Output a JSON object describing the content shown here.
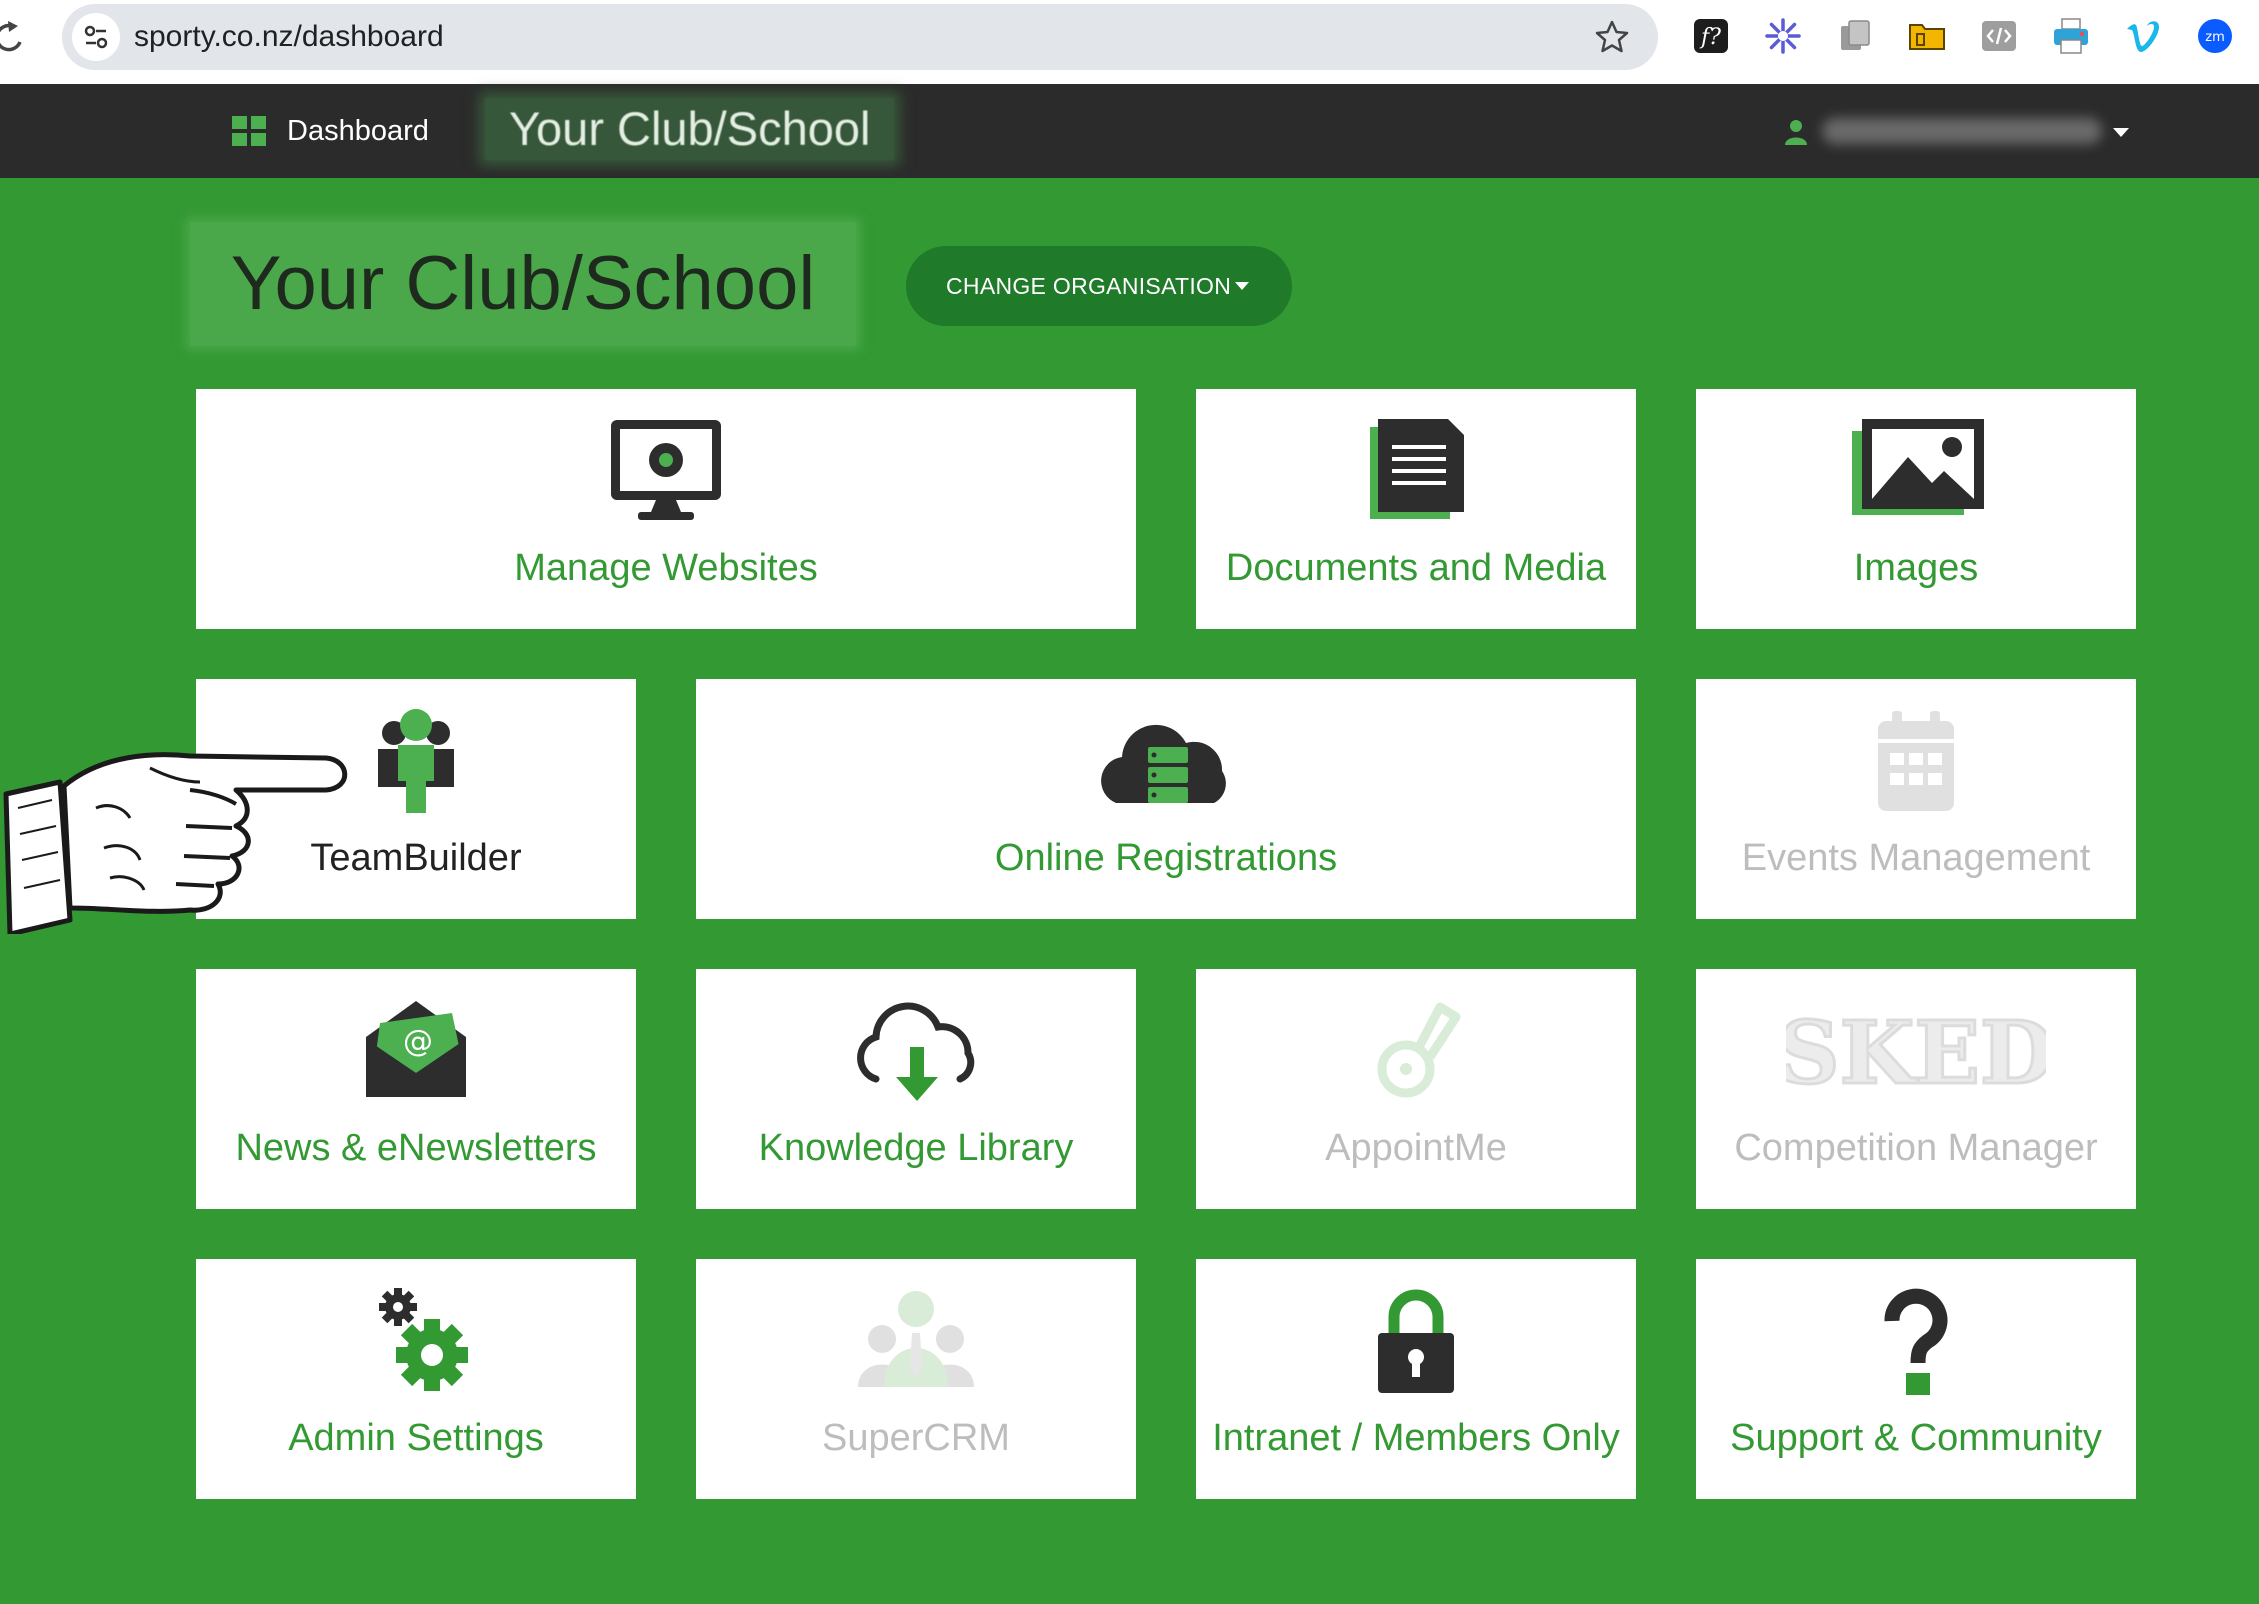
{
  "browser": {
    "url": "sporty.co.nz/dashboard",
    "extensions": [
      "formula-icon",
      "asterisk-icon",
      "copy-icon",
      "folder-icon",
      "code-icon",
      "printer-icon",
      "vimeo-icon",
      "zoom-icon"
    ]
  },
  "navbar": {
    "dashboard_label": "Dashboard",
    "club_name": "Your Club/School"
  },
  "header": {
    "org_title": "Your Club/School",
    "change_org_label": "CHANGE ORGANISATION"
  },
  "colors": {
    "page_bg": "#339933",
    "navbar_bg": "#2b2b2b",
    "accent_green": "#339933",
    "dark_green_button": "#1f7a2a",
    "disabled_text": "#bdbdbd"
  },
  "tiles": [
    {
      "label": "Manage Websites",
      "icon": "monitor-icon",
      "state": "active"
    },
    {
      "label": "Documents and Media",
      "icon": "document-icon",
      "state": "active"
    },
    {
      "label": "Images",
      "icon": "image-icon",
      "state": "active"
    },
    {
      "label": "TeamBuilder",
      "icon": "team-icon",
      "state": "active"
    },
    {
      "label": "Online Registrations",
      "icon": "cloud-server-icon",
      "state": "active"
    },
    {
      "label": "Events Management",
      "icon": "calendar-icon",
      "state": "disabled"
    },
    {
      "label": "News & eNewsletters",
      "icon": "email-icon",
      "state": "active"
    },
    {
      "label": "Knowledge Library",
      "icon": "cloud-download-icon",
      "state": "active"
    },
    {
      "label": "AppointMe",
      "icon": "whistle-icon",
      "state": "disabled"
    },
    {
      "label": "Competition Manager",
      "icon": "sked-logo-icon",
      "state": "disabled",
      "logo_text": "SKED"
    },
    {
      "label": "Admin Settings",
      "icon": "gears-icon",
      "state": "active"
    },
    {
      "label": "SuperCRM",
      "icon": "people-icon",
      "state": "disabled"
    },
    {
      "label": "Intranet / Members Only",
      "icon": "lock-icon",
      "state": "active"
    },
    {
      "label": "Support & Community",
      "icon": "question-icon",
      "state": "active"
    }
  ]
}
